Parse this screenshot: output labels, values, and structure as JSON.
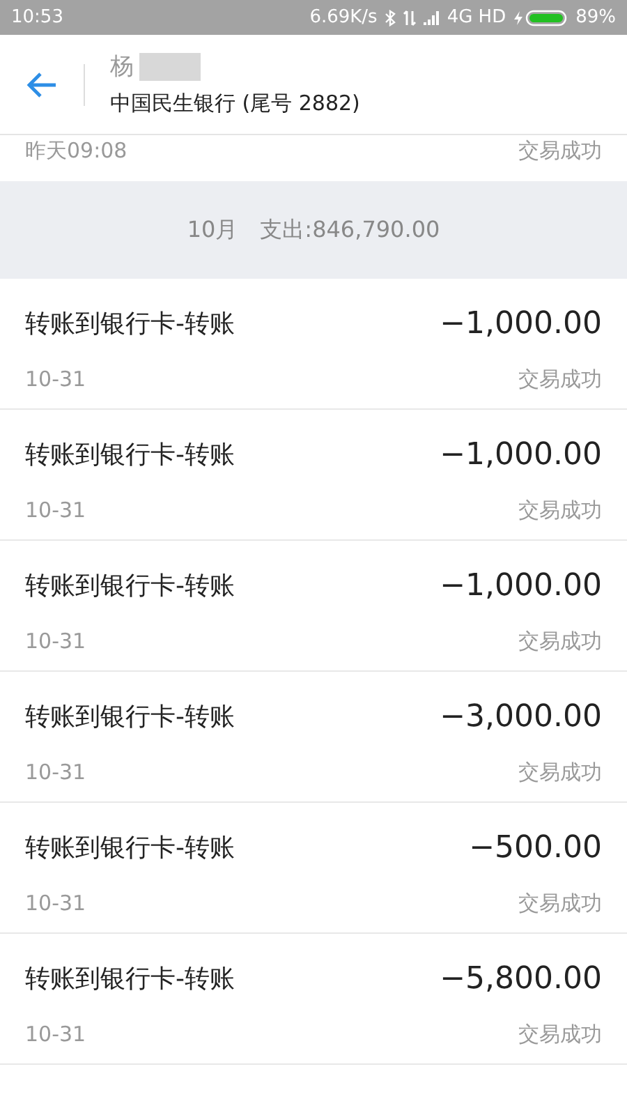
{
  "status_bar": {
    "time": "10:53",
    "speed": "6.69K/s",
    "network": "4G HD",
    "battery": "89%"
  },
  "header": {
    "name": "杨",
    "account": "中国民生银行 (尾号 2882)"
  },
  "partial_row": {
    "date": "昨天09:08",
    "status": "交易成功"
  },
  "month_summary": {
    "month": "10月",
    "total": "支出:846,790.00"
  },
  "transactions": [
    {
      "title": "转账到银行卡-转账",
      "amount": "−1,000.00",
      "date": "10-31",
      "status": "交易成功"
    },
    {
      "title": "转账到银行卡-转账",
      "amount": "−1,000.00",
      "date": "10-31",
      "status": "交易成功"
    },
    {
      "title": "转账到银行卡-转账",
      "amount": "−1,000.00",
      "date": "10-31",
      "status": "交易成功"
    },
    {
      "title": "转账到银行卡-转账",
      "amount": "−3,000.00",
      "date": "10-31",
      "status": "交易成功"
    },
    {
      "title": "转账到银行卡-转账",
      "amount": "−500.00",
      "date": "10-31",
      "status": "交易成功"
    },
    {
      "title": "转账到银行卡-转账",
      "amount": "−5,800.00",
      "date": "10-31",
      "status": "交易成功"
    }
  ]
}
